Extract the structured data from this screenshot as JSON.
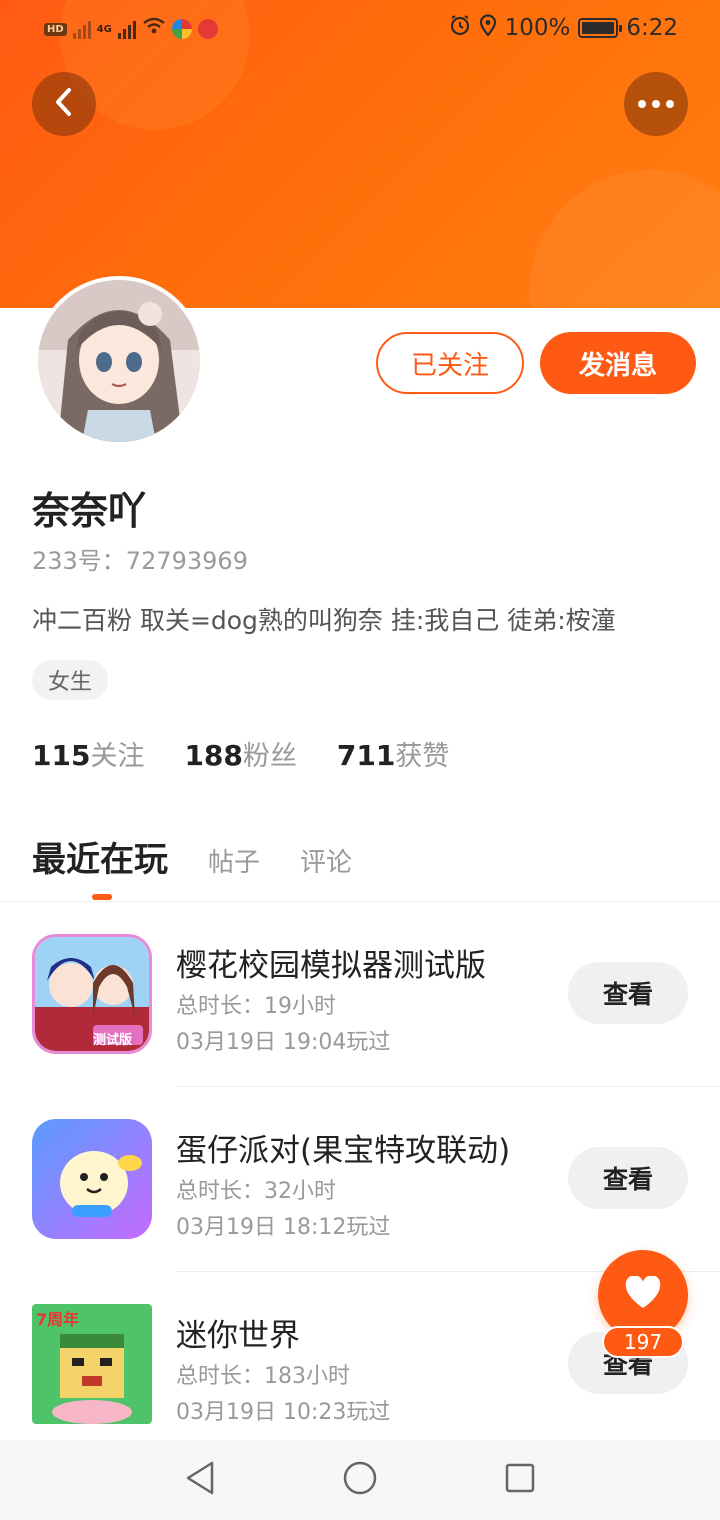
{
  "status_bar": {
    "hd": "HD",
    "network": "4G",
    "battery_percent": "100%",
    "time": "6:22",
    "icons": [
      "signal-icon",
      "wifi-icon",
      "alarm-icon",
      "location-icon",
      "battery-icon"
    ]
  },
  "header": {
    "back_icon": "chevron-left-icon",
    "more_icon": "more-dots-icon",
    "accent_color": "#ff5a14"
  },
  "profile": {
    "followed_label": "已关注",
    "message_label": "发消息",
    "username": "奈奈吖",
    "id_text": "233号：72793969",
    "bio": "冲二百粉 取关=dog熟的叫狗奈 挂:我自己 徒弟:桉潼",
    "gender_tag": "女生"
  },
  "stats": [
    {
      "value": "115",
      "label": "关注"
    },
    {
      "value": "188",
      "label": "粉丝"
    },
    {
      "value": "711",
      "label": "获赞"
    }
  ],
  "tabs": [
    {
      "label": "最近在玩",
      "active": true
    },
    {
      "label": "帖子",
      "active": false
    },
    {
      "label": "评论",
      "active": false
    }
  ],
  "games": [
    {
      "name": "樱花校园模拟器测试版",
      "duration": "总时长：19小时",
      "last_played": "03月19日 19:04玩过",
      "view_label": "查看",
      "icon_badge": "测试版"
    },
    {
      "name": "蛋仔派对(果宝特攻联动)",
      "duration": "总时长：32小时",
      "last_played": "03月19日 18:12玩过",
      "view_label": "查看",
      "icon_badge": ""
    },
    {
      "name": "迷你世界",
      "duration": "总时长：183小时",
      "last_played": "03月19日 10:23玩过",
      "view_label": "查看",
      "icon_badge": "7周年"
    }
  ],
  "like": {
    "count": "197",
    "icon": "heart-icon"
  },
  "nav": {
    "icons": [
      "nav-back-icon",
      "nav-home-icon",
      "nav-recents-icon"
    ]
  }
}
